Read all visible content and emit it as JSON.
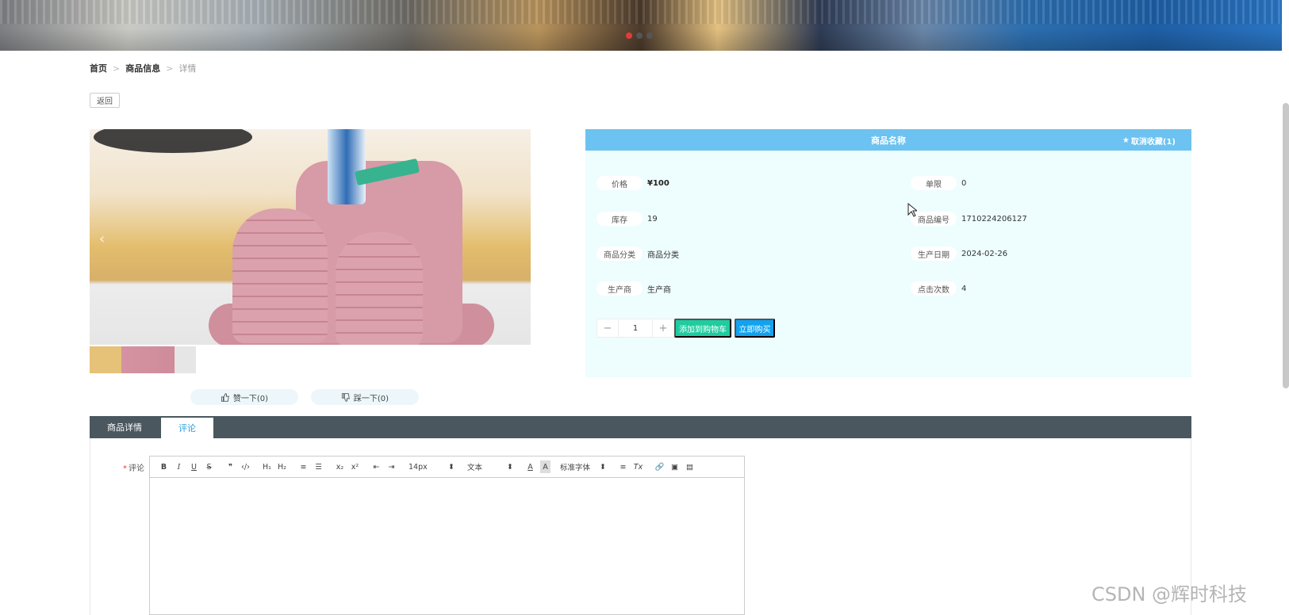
{
  "banner": {
    "slides": 3,
    "active_slide": 1
  },
  "breadcrumb": {
    "home": "首页",
    "category": "商品信息",
    "current": "详情",
    "separator": ">"
  },
  "back_button": "返回",
  "product": {
    "title": "商品名称",
    "favorite": {
      "icon": "star-icon",
      "label": "取消收藏(1)"
    },
    "fields": {
      "price_label": "价格",
      "price_value": "¥100",
      "limit_label": "单限",
      "limit_value": "0",
      "stock_label": "库存",
      "stock_value": "19",
      "code_label": "商品编号",
      "code_value": "1710224206127",
      "category_label": "商品分类",
      "category_value": "商品分类",
      "date_label": "生产日期",
      "date_value": "2024-02-26",
      "maker_label": "生产商",
      "maker_value": "生产商",
      "clicks_label": "点击次数",
      "clicks_value": "4"
    },
    "quantity": {
      "minus": "−",
      "value": "1",
      "plus": "+"
    },
    "add_to_cart": "添加到购物车",
    "buy_now": "立即购买"
  },
  "votes": {
    "like": "赞一下(0)",
    "dislike": "踩一下(0)"
  },
  "tabs": {
    "details": "商品详情",
    "comments": "评论"
  },
  "comment_form": {
    "label": "评论",
    "required_mark": "*",
    "toolbar": {
      "bold": "B",
      "italic": "I",
      "underline": "U",
      "strike": "S",
      "quote": "❞",
      "code": "‹/›",
      "h1": "H₁",
      "h2": "H₂",
      "ordered_list": "≡",
      "bullet_list": "☰",
      "subscript": "x₂",
      "superscript": "x²",
      "outdent": "⇤",
      "indent": "⇥",
      "font_size": "14px",
      "text_style": "文本",
      "font_color": "A",
      "background_color": "A",
      "font_family": "标准字体",
      "align": "≡",
      "clear_format": "Tx",
      "link": "🔗",
      "image": "▣",
      "video": "▤",
      "select_arrow": "⬍"
    }
  },
  "watermark": "CSDN @辉时科技"
}
